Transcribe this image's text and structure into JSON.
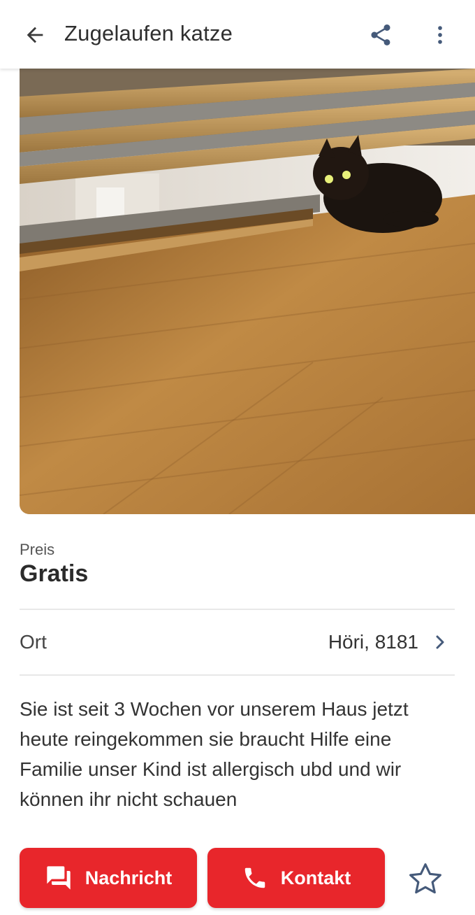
{
  "header": {
    "title": "Zugelaufen katze"
  },
  "listing": {
    "price_label": "Preis",
    "price_value": "Gratis",
    "location_label": "Ort",
    "location_value": "Höri, 8181",
    "description": "Sie ist seit 3 Wochen vor unserem Haus jetzt heute reingekommen sie braucht Hilfe eine Familie unser Kind ist allergisch ubd und wir können ihr nicht schauen"
  },
  "actions": {
    "message_label": "Nachricht",
    "contact_label": "Kontakt"
  },
  "icons": {
    "back": "arrow-back-icon",
    "share": "share-icon",
    "more": "more-vert-icon",
    "chevron": "chevron-right-icon",
    "message": "forum-icon",
    "phone": "phone-icon",
    "favorite": "star-outline-icon"
  },
  "colors": {
    "accent": "#e8262b",
    "text": "#333333",
    "icon": "#455a7a"
  }
}
